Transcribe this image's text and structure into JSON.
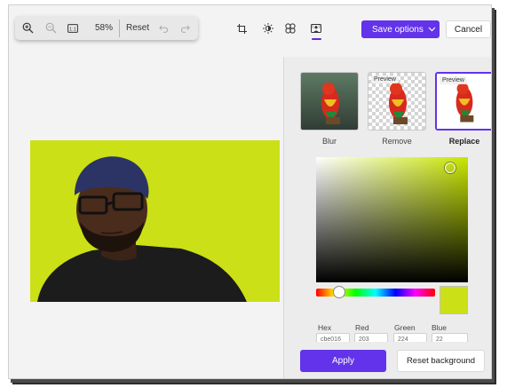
{
  "zoom_toolbar": {
    "zoom_in_icon": "zoom-in-icon",
    "zoom_out_icon": "zoom-out-icon",
    "fit_icon": "fit-to-window-icon",
    "zoom_level": "58%",
    "reset_label": "Reset",
    "undo_icon": "undo-icon",
    "redo_icon": "redo-icon"
  },
  "edit_tools": [
    {
      "name": "crop-icon"
    },
    {
      "name": "adjust-brightness-icon"
    },
    {
      "name": "filter-icon"
    },
    {
      "name": "background-icon",
      "active": true
    }
  ],
  "actions": {
    "save_label": "Save options",
    "cancel_label": "Cancel"
  },
  "background_panel": {
    "options": [
      {
        "label": "Blur",
        "preview_tag": "",
        "selected": false
      },
      {
        "label": "Remove",
        "preview_tag": "Preview",
        "selected": false
      },
      {
        "label": "Replace",
        "preview_tag": "Preview",
        "selected": true
      }
    ],
    "selected_color": "#cbe016",
    "fields": [
      {
        "label": "Hex",
        "value": "cbe016"
      },
      {
        "label": "Red",
        "value": "203"
      },
      {
        "label": "Green",
        "value": "224"
      },
      {
        "label": "Blue",
        "value": "22"
      }
    ],
    "apply_label": "Apply",
    "reset_background_label": "Reset background"
  },
  "colors": {
    "accent": "#6233ea",
    "background_replacement": "#cbe016"
  }
}
